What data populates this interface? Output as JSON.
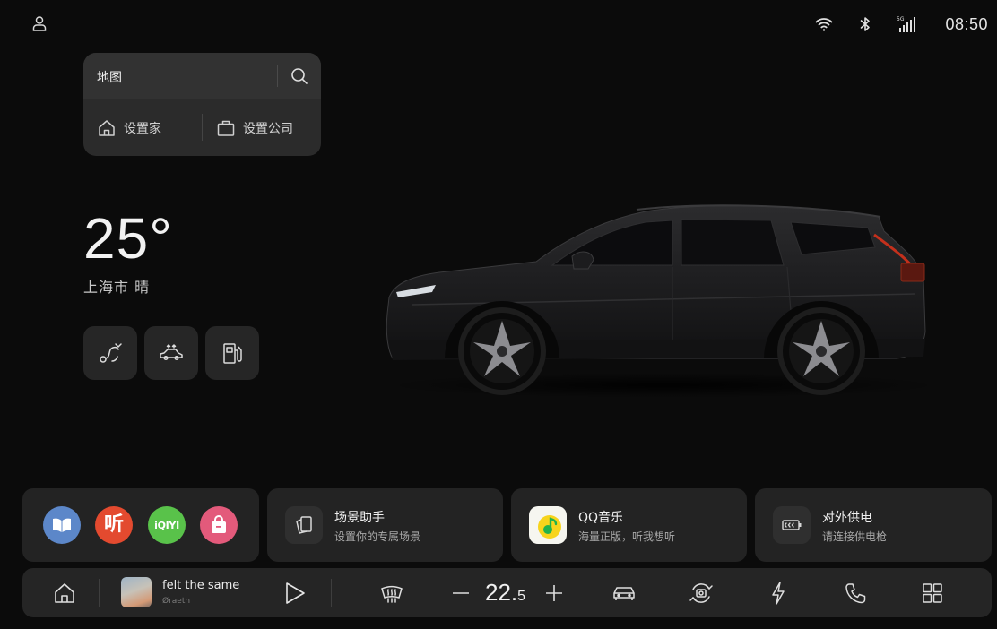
{
  "status": {
    "icons": [
      "user-icon",
      "wifi-icon",
      "bluetooth-icon",
      "5g-signal-icon"
    ],
    "signal_label": "5G",
    "time": "08:50"
  },
  "map": {
    "title": "地图",
    "home_label": "设置家",
    "work_label": "设置公司"
  },
  "weather": {
    "temperature": "25°",
    "location": "上海市 晴"
  },
  "quick_actions": [
    "route-icon",
    "car-lift-icon",
    "fuel-station-icon"
  ],
  "apps": {
    "iqiyi_label": "iQIYI",
    "listen_label": "听"
  },
  "scene": {
    "title": "场景助手",
    "subtitle": "设置你的专属场景"
  },
  "music_card": {
    "title": "QQ音乐",
    "subtitle": "海量正版，听我想听"
  },
  "power": {
    "title": "对外供电",
    "subtitle": "请连接供电枪"
  },
  "dock": {
    "song_title": "felt the same",
    "artist": "Øraeth",
    "temp_whole": "22.",
    "temp_decimal": "5"
  },
  "colors": {
    "background": "#0b0b0b",
    "card": "#232323",
    "read_app": "#5c87c9",
    "listen_app": "#e34a2f",
    "iqiyi_app": "#59c24a",
    "shop_app": "#e35a7b"
  }
}
